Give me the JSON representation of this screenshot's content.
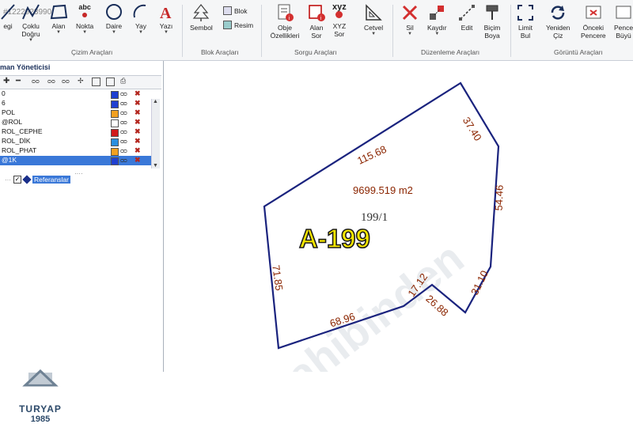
{
  "watermark_id": "#1222923990",
  "ribbon": {
    "tools": {
      "cizgi": "egi",
      "coklu": "Çoklu\nDoğru",
      "alan": "Alan",
      "nokta": "Nokta",
      "daire": "Daire",
      "yay": "Yay",
      "yazi": "Yazı",
      "sembol": "Sembol",
      "blok": "Blok",
      "resim": "Resim",
      "obje": "Obje\nÖzellikleri",
      "alan_sor": "Alan\nSor",
      "xyz_sor": "XYZ\nSor",
      "cetvel": "Cetvel",
      "sil": "Sil",
      "kaydir": "Kaydır",
      "edit": "Edit",
      "bicim": "Biçim\nBoya",
      "limit": "Limit\nBul",
      "yeniden": "Yeniden\nÇiz",
      "onceki": "Önceki\nPencere",
      "pencere": "Pence\nBüyü"
    },
    "abc_glyph": "abc",
    "xyz_glyph": "xyz",
    "groups": {
      "cizim": "Çizim Araçları",
      "blok": "Blok Araçları",
      "sorgu": "Sorgu Araçları",
      "duzenleme": "Düzenleme Araçları",
      "goruntu": "Görüntü Araçları"
    }
  },
  "panel": {
    "title": "man Yöneticisi",
    "layers": [
      {
        "name": "0",
        "color": "#1f3fd1"
      },
      {
        "name": "6",
        "color": "#1f3fd1"
      },
      {
        "name": "POL",
        "color": "#f2a020"
      },
      {
        "name": "@ROL",
        "color": "#ffffff"
      },
      {
        "name": "ROL_CEPHE",
        "color": "#d11a1a"
      },
      {
        "name": "ROL_DİK",
        "color": "#2a8fe0"
      },
      {
        "name": "ROL_PHAT",
        "color": "#f2a020"
      },
      {
        "name": "@1K",
        "color": "#1f3fd1"
      }
    ],
    "tree_item": "Referanslar"
  },
  "drawing": {
    "area_text": "9699.519 m2",
    "parcel_no": "199/1",
    "parcel_label": "A-199",
    "edges": [
      "115.68",
      "37.40",
      "54.46",
      "31.10",
      "26.88",
      "17.12",
      "68.96",
      "71.85"
    ],
    "watermark": "sahibinden"
  },
  "logo": {
    "name": "TURYAP",
    "year": "1985"
  },
  "colors": {
    "polygon": "#1a237e",
    "dimension": "#8b2500",
    "label": "#f5e600",
    "selection": "#3a78d8"
  }
}
